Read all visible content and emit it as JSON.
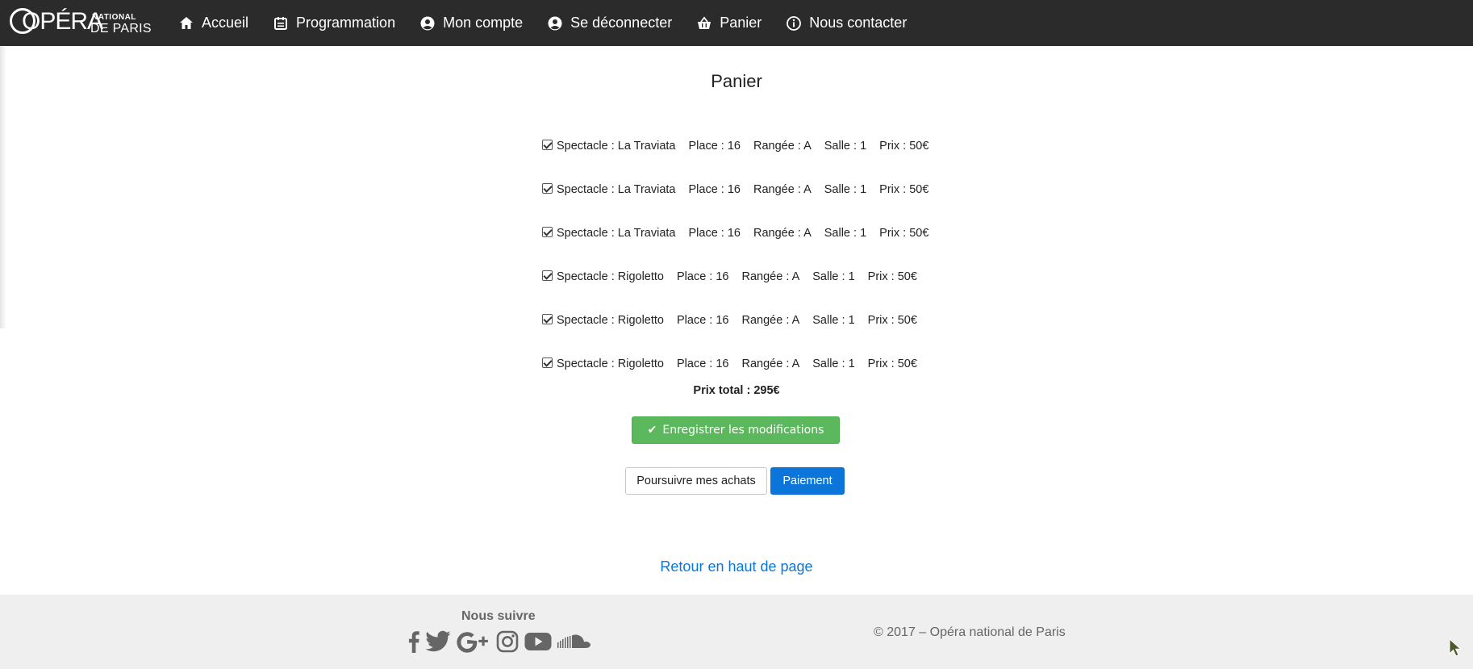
{
  "brand": {
    "logo_word": "OPÉRA",
    "logo_national": "NATIONAL",
    "logo_de_paris": "DE PARIS"
  },
  "nav": [
    {
      "label": "Accueil",
      "icon": "home-icon"
    },
    {
      "label": "Programmation",
      "icon": "calendar-icon"
    },
    {
      "label": "Mon compte",
      "icon": "user-circle-icon"
    },
    {
      "label": "Se déconnecter",
      "icon": "user-circle-icon"
    },
    {
      "label": "Panier",
      "icon": "basket-icon"
    },
    {
      "label": "Nous contacter",
      "icon": "info-icon"
    }
  ],
  "cart": {
    "title": "Panier",
    "items": [
      {
        "checked": true,
        "show": "Spectacle : La Traviata",
        "place": "Place : 16",
        "row": "Rangée : A",
        "hall": "Salle : 1",
        "price": "Prix : 50€"
      },
      {
        "checked": true,
        "show": "Spectacle : La Traviata",
        "place": "Place : 16",
        "row": "Rangée : A",
        "hall": "Salle : 1",
        "price": "Prix : 50€"
      },
      {
        "checked": true,
        "show": "Spectacle : La Traviata",
        "place": "Place : 16",
        "row": "Rangée : A",
        "hall": "Salle : 1",
        "price": "Prix : 50€"
      },
      {
        "checked": true,
        "show": "Spectacle : Rigoletto",
        "place": "Place : 16",
        "row": "Rangée : A",
        "hall": "Salle : 1",
        "price": "Prix : 50€"
      },
      {
        "checked": true,
        "show": "Spectacle : Rigoletto",
        "place": "Place : 16",
        "row": "Rangée : A",
        "hall": "Salle : 1",
        "price": "Prix : 50€"
      },
      {
        "checked": true,
        "show": "Spectacle : Rigoletto",
        "place": "Place : 16",
        "row": "Rangée : A",
        "hall": "Salle : 1",
        "price": "Prix : 50€"
      }
    ],
    "total": "Prix total : 295€",
    "save_label": "Enregistrer les modifications",
    "continue_label": "Poursuivre mes achats",
    "pay_label": "Paiement"
  },
  "back_to_top": "Retour en haut de page",
  "footer": {
    "follow_label": "Nous suivre",
    "socials": [
      "facebook-icon",
      "twitter-icon",
      "google-plus-icon",
      "instagram-icon",
      "youtube-icon",
      "soundcloud-icon"
    ],
    "copyright": "© 2017 – Opéra national de Paris"
  },
  "colors": {
    "topbar": "#2b2b2b",
    "save_button": "#5cb85c",
    "pay_button": "#0b75d9",
    "link": "#0b75d9",
    "footer_bg": "#efefef"
  }
}
